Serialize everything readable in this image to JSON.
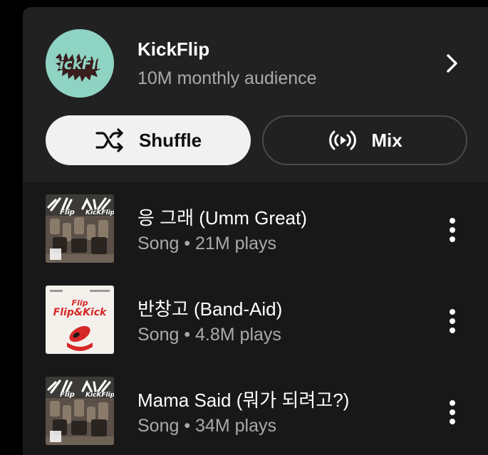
{
  "artist": {
    "name": "KickFlip",
    "subtitle": "10M monthly audience",
    "logo_text": "KickFlip",
    "avatar_color": "#8fd3c3"
  },
  "actions": {
    "shuffle_label": "Shuffle",
    "mix_label": "Mix"
  },
  "songs": [
    {
      "title": "응 그래 (Umm Great)",
      "meta": "Song • 21M plays",
      "cover": "flip-for-kickflip"
    },
    {
      "title": "반창고 (Band-Aid)",
      "meta": "Song • 4.8M plays",
      "cover": "flip-it-kick-it"
    },
    {
      "title": "Mama Said (뭐가 되려고?)",
      "meta": "Song • 34M plays",
      "cover": "flip-for-kickflip"
    }
  ],
  "colors": {
    "background": "#000000",
    "card": "#212121",
    "list": "#181818",
    "primary_text": "#ffffff",
    "secondary_text": "#aaaaaa",
    "shuffle_bg": "#f1f1f1",
    "cover_red": "#d62828"
  }
}
